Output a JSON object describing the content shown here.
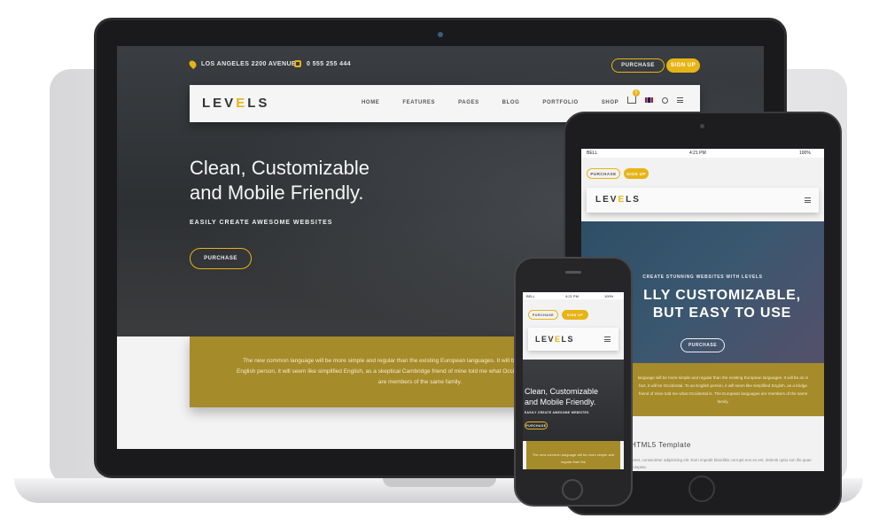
{
  "desktop": {
    "topbar": {
      "address": "LOS ANGELES 2200 AVENUE",
      "phone": "0 555 255 444"
    },
    "purchase_label": "PURCHASE",
    "signup_label": "SIGN UP",
    "logo": {
      "pre": "LEV",
      "accent": "E",
      "post": "LS"
    },
    "nav": [
      "HOME",
      "FEATURES",
      "PAGES",
      "BLOG",
      "PORTFOLIO",
      "SHOP"
    ],
    "cart_count": "0",
    "hero": {
      "title_line1": "Clean, Customizable",
      "title_line2": "and Mobile Friendly.",
      "subtitle": "EASILY CREATE AWESOME WEBSITES",
      "button": "PURCHASE"
    },
    "band_text": "The new common language will be more simple and regular than the existing European languages. It will be as simple as Occidental. To an English person, it will seem like simplified English, as a skeptical Cambridge friend of mine told me what Occidental is. The European languages are members of the same family."
  },
  "tablet": {
    "status": {
      "carrier": "BELL",
      "time": "4:21 PM",
      "battery": "100%"
    },
    "purchase_label": "PURCHASE",
    "signup_label": "SIGN UP",
    "logo": {
      "pre": "LEV",
      "accent": "E",
      "post": "LS"
    },
    "hero": {
      "subtitle": "CREATE STUNNING WEBSITES WITH LEVELS",
      "title_line1": "LLY CUSTOMIZABLE,",
      "title_line2": "BUT EASY TO USE",
      "button": "PURCHASE"
    },
    "band_text": "language will be more simple and regular than the existing European languages. It will be as in fact, it will be Occidental. To an English person, it will seem like simplified English, as a bridge friend of mine told me what Occidental is. The European languages are members of the same family.",
    "section_title": "HTML5 Template",
    "section_text": "amet, consectetur adipisicing elit. Eum impedit blanditiis corrupti eos ex est, deleniti optio sun illo quae voluptas."
  },
  "phone": {
    "status": {
      "carrier": "BELL",
      "time": "4:21 PM",
      "battery": "100%"
    },
    "purchase_label": "PURCHASE",
    "signup_label": "SIGN UP",
    "logo": {
      "pre": "LEV",
      "accent": "E",
      "post": "LS"
    },
    "hero": {
      "title_line1": "Clean, Customizable",
      "title_line2": "and Mobile Friendly.",
      "subtitle": "EASILY CREATE AWESOME WEBSITES",
      "button": "PURCHASE"
    },
    "band_text": "The new common language will be more simple and regular than the"
  },
  "colors": {
    "accent": "#e7b416",
    "band": "#a68b2a",
    "dark": "#2e3134"
  }
}
